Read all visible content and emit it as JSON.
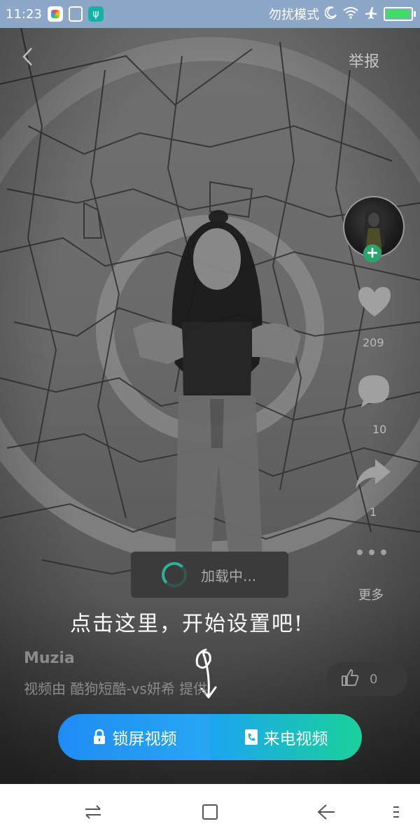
{
  "status_bar": {
    "time": "11:23",
    "mode": "勿扰模式",
    "icons": [
      "app-icon",
      "fingerprint-app-icon",
      "usb-icon",
      "moon-icon",
      "wifi-icon",
      "airplane-icon",
      "battery-icon"
    ],
    "battery_color": "#3ddc63"
  },
  "header": {
    "back_icon": "chevron-left-icon",
    "report_label": "举报"
  },
  "rail": {
    "likes_count": "209",
    "comments_count": "10",
    "shares_count": "1",
    "more_label": "更多"
  },
  "loading": {
    "label": "加载中..."
  },
  "tip": {
    "text": "点击这里，开始设置吧!"
  },
  "video_info": {
    "author": "Muzia",
    "provider": "视频由 酷狗短酷-vs妍希 提供"
  },
  "like_pill": {
    "count": "0"
  },
  "cta": {
    "lock_screen_label": "锁屏视频",
    "incoming_call_label": "来电视频",
    "left_color": "#1f8cf4",
    "right_color": "#1ad19a"
  },
  "navbar": {
    "buttons": [
      "switch-icon",
      "square-icon",
      "back-arrow-icon",
      "menu-icon"
    ]
  }
}
